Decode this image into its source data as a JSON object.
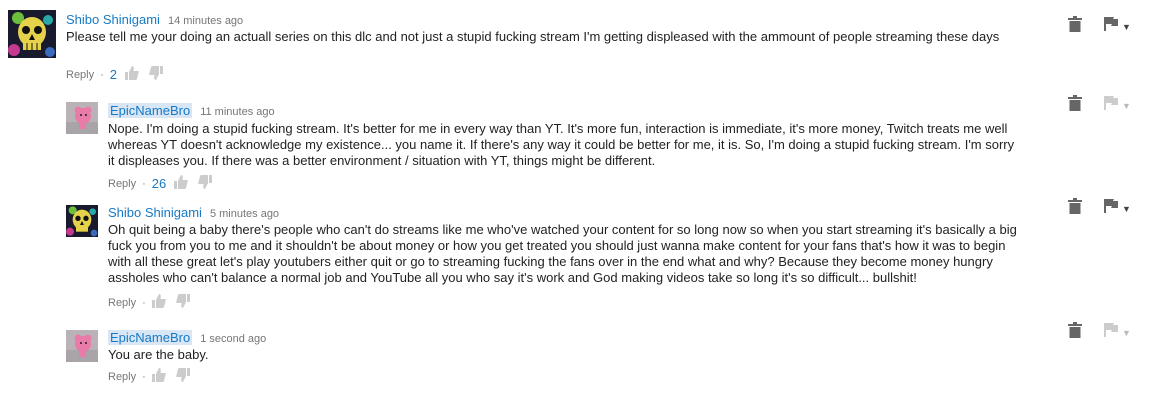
{
  "comments": [
    {
      "author": "Shibo Shinigami",
      "time": "14 minutes ago",
      "text": "Please tell me your doing an actuall series on this dlc and not just a stupid fucking stream I'm getting displeased with the ammount of people streaming these days",
      "reply_label": "Reply",
      "separator": "·",
      "likes": "2",
      "avatar_icon": "skull-avatar",
      "caret": "▼"
    },
    {
      "author": "EpicNameBro",
      "time": "11 minutes ago",
      "text": "Nope. I'm doing a stupid fucking stream. It's better for me in every way than YT. It's more fun, interaction is immediate, it's more money, Twitch treats me well whereas YT doesn't acknowledge my existence... you name it. If there's any way it could be better for me, it is. So, I'm doing a stupid fucking stream. I'm sorry it displeases you. If there was a better environment / situation with YT, things might be different.",
      "reply_label": "Reply",
      "separator": "·",
      "likes": "26",
      "avatar_icon": "pink-plush-avatar",
      "caret": "▼"
    },
    {
      "author": "Shibo Shinigami",
      "time": "5 minutes ago",
      "text": "Oh quit being a baby there's people who can't do streams like me who've watched your content for so long now so when you start streaming it's basically a big fuck you from you to me and it shouldn't be about money or how you get treated you should just wanna make content for your fans that's how it was to begin with all these great let's play youtubers either quit or go to streaming fucking the fans over in the end what and why? Because they become money hungry assholes who can't balance a normal job and YouTube all you who say it's work and God making videos take so long it's so difficult... bullshit!",
      "reply_label": "Reply",
      "separator": "·",
      "likes": "",
      "avatar_icon": "skull-avatar",
      "caret": "▼"
    },
    {
      "author": "EpicNameBro",
      "time": "1 second ago",
      "text": "You are the baby.",
      "reply_label": "Reply",
      "separator": "·",
      "likes": "",
      "avatar_icon": "pink-plush-avatar",
      "caret": "▼"
    }
  ],
  "colors": {
    "author": "#167ac6",
    "highlight": "#d8e6f5",
    "meta": "#767676",
    "icon": "#666666",
    "icon_faded": "#cccccc"
  }
}
